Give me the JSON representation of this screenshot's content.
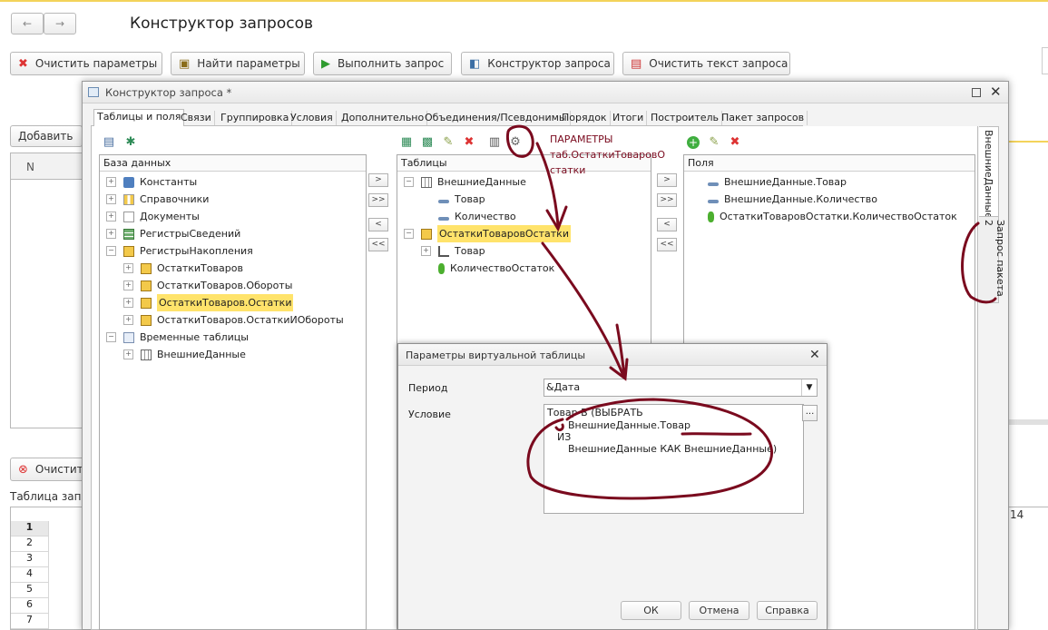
{
  "app": {
    "title": "Конструктор запросов",
    "nav_back": "←",
    "nav_forward": "→",
    "toolbar": [
      {
        "label": "Очистить параметры",
        "icon": "clear-x-icon"
      },
      {
        "label": "Найти параметры",
        "icon": "find-params-icon"
      },
      {
        "label": "Выполнить запрос",
        "icon": "play-icon"
      },
      {
        "label": "Конструктор запроса",
        "icon": "constructor-icon"
      },
      {
        "label": "Очистить текст запроса",
        "icon": "clear-doc-icon"
      }
    ],
    "add_label": "Добавить",
    "n_col": "N",
    "clear_label": "Очистит",
    "table_label": "Таблица запр",
    "row_numbers": [
      "1",
      "2",
      "3",
      "4",
      "5",
      "6",
      "7"
    ],
    "right_cell": "14"
  },
  "dialog": {
    "title": "Конструктор запроса *",
    "tabs": [
      "Таблицы и поля",
      "Связи",
      "Группировка",
      "Условия",
      "Дополнительно",
      "Объединения/Псевдонимы",
      "Порядок",
      "Итоги",
      "Построитель",
      "Пакет запросов"
    ],
    "side_tabs": [
      "ВнешниеДанные",
      "Запрос пакета 2"
    ],
    "db_header": "База данных",
    "db_tree": [
      {
        "label": "Константы",
        "level": 0,
        "exp": "+",
        "icon": "constants-icon"
      },
      {
        "label": "Справочники",
        "level": 0,
        "exp": "+",
        "icon": "catalogs-icon"
      },
      {
        "label": "Документы",
        "level": 0,
        "exp": "+",
        "icon": "documents-icon"
      },
      {
        "label": "РегистрыСведений",
        "level": 0,
        "exp": "+",
        "icon": "info-registers-icon"
      },
      {
        "label": "РегистрыНакопления",
        "level": 0,
        "exp": "−",
        "icon": "accum-registers-icon"
      },
      {
        "label": "ОстаткиТоваров",
        "level": 1,
        "exp": "+",
        "icon": "register-icon"
      },
      {
        "label": "ОстаткиТоваров.Обороты",
        "level": 1,
        "exp": "+",
        "icon": "register-icon"
      },
      {
        "label": "ОстаткиТоваров.Остатки",
        "level": 1,
        "exp": "+",
        "icon": "register-icon",
        "selected": true
      },
      {
        "label": "ОстаткиТоваров.ОстаткиИОбороты",
        "level": 1,
        "exp": "+",
        "icon": "register-icon"
      },
      {
        "label": "Временные таблицы",
        "level": 0,
        "exp": "−",
        "icon": "temp-tables-icon"
      },
      {
        "label": "ВнешниеДанные",
        "level": 1,
        "exp": "+",
        "icon": "table-icon"
      }
    ],
    "tables_header": "Таблицы",
    "tables_tree": [
      {
        "label": "ВнешниеДанные",
        "level": 0,
        "exp": "−",
        "icon": "table-icon"
      },
      {
        "label": "Товар",
        "level": 1,
        "icon": "field-icon"
      },
      {
        "label": "Количество",
        "level": 1,
        "icon": "field-icon"
      },
      {
        "label": "ОстаткиТоваровОстатки",
        "level": 0,
        "exp": "−",
        "icon": "register-icon",
        "selected": true
      },
      {
        "label": "Товар",
        "level": 1,
        "exp": "+",
        "icon": "ref-field-icon"
      },
      {
        "label": "КоличествоОстаток",
        "level": 1,
        "icon": "resource-icon"
      }
    ],
    "fields_header": "Поля",
    "fields": [
      {
        "label": "ВнешниеДанные.Товар",
        "icon": "field-icon"
      },
      {
        "label": "ВнешниеДанные.Количество",
        "icon": "field-icon"
      },
      {
        "label": "ОстаткиТоваровОстатки.КоличествоОстаток",
        "icon": "resource-icon"
      }
    ],
    "move_buttons": [
      ">",
      ">>",
      "<",
      "<<"
    ]
  },
  "annotation": {
    "line1": "ПАРАМЕТРЫ",
    "line2": "таб.ОстаткиТоваровО",
    "line3": "статки"
  },
  "params_dialog": {
    "title": "Параметры виртуальной таблицы",
    "period_label": "Период",
    "period_value": "&Дата",
    "condition_label": "Условие",
    "condition_lines": [
      "Товар В (ВЫБРАТЬ",
      "ВнешниеДанные.Товар",
      "ИЗ",
      "ВнешниеДанные КАК ВнешниеДанные)"
    ],
    "ellipsis": "...",
    "ok": "ОК",
    "cancel": "Отмена",
    "help": "Справка"
  },
  "colors": {
    "selection": "#ffe36b",
    "annotation": "#7a0a1e",
    "accent": "#2f7d2f"
  }
}
